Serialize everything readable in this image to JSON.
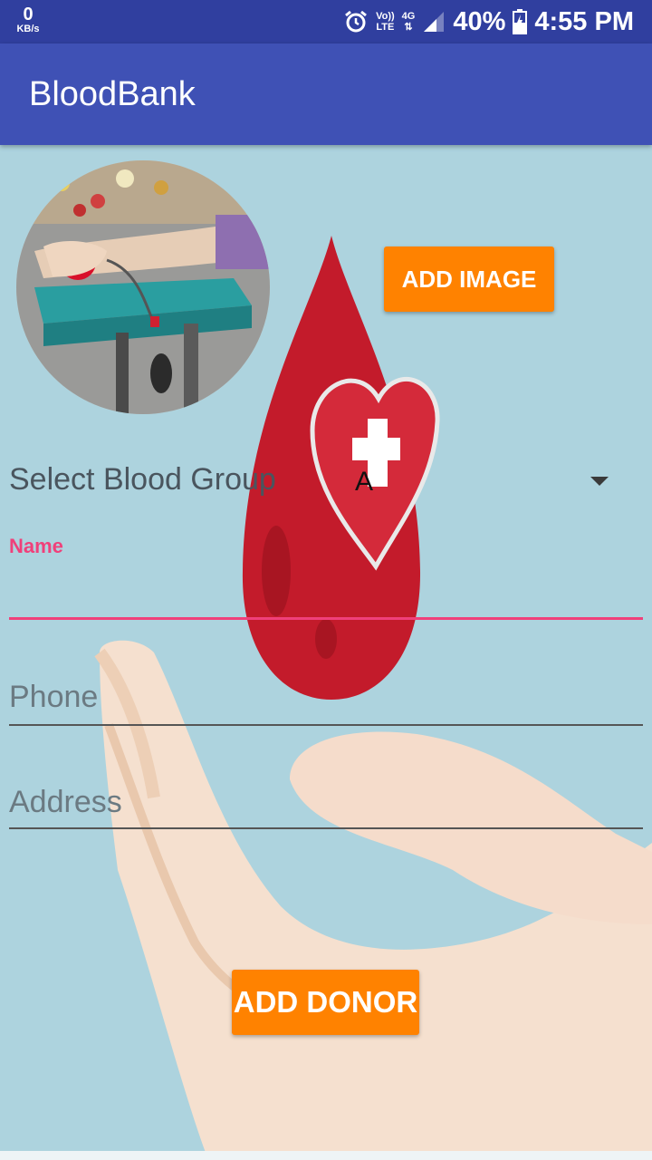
{
  "status_bar": {
    "net_speed": "0",
    "net_unit": "KB/s",
    "volte_line1": "Vo))",
    "volte_line2": "LTE",
    "net_type": "4G",
    "battery": "40%",
    "time": "4:55 PM",
    "icons": [
      "alarm-icon",
      "signal-icon",
      "battery-icon"
    ]
  },
  "app_bar": {
    "title": "BloodBank"
  },
  "photo": {
    "description_icon": "blood-donation-photo"
  },
  "add_image_button": "ADD IMAGE",
  "blood_group": {
    "label": "Select Blood Group",
    "selected": "A"
  },
  "form": {
    "name_label": "Name",
    "name_value": "",
    "phone_placeholder": "Phone",
    "address_placeholder": "Address"
  },
  "add_donor_button": "ADD DONOR",
  "colors": {
    "status_bar": "#303f9f",
    "app_bar": "#3f51b5",
    "accent": "#f0407a",
    "button": "#ff8200",
    "background": "#add3de",
    "blood_drop": "#c31b2b"
  }
}
